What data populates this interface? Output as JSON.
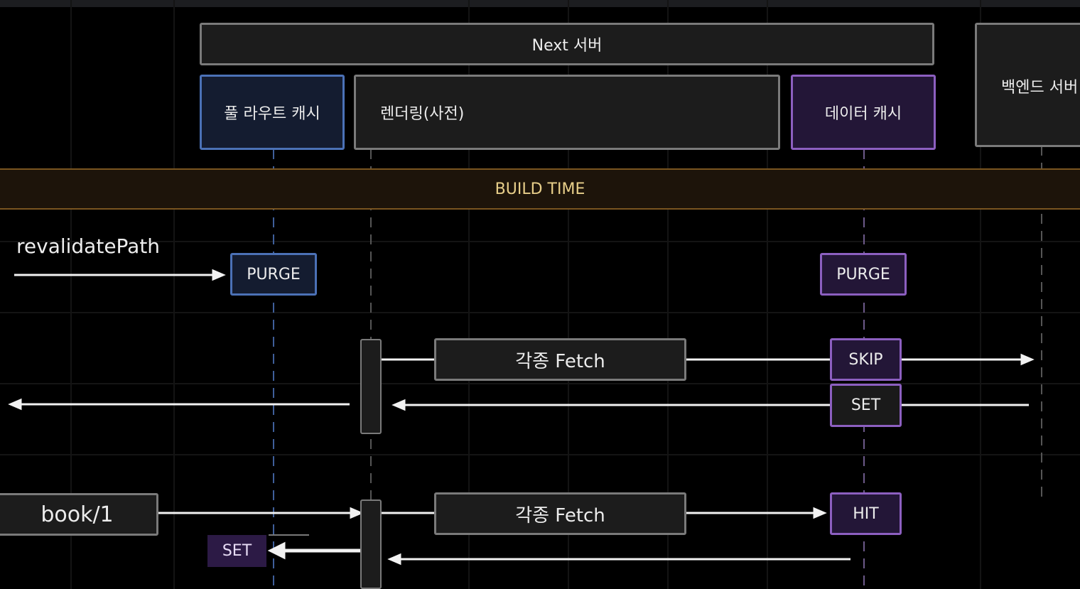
{
  "header": {
    "server": "Next 서버",
    "backend": "백엔드 서버"
  },
  "columns": {
    "full_route_cache": "풀 라우트 캐시",
    "rendering": "렌더링(사전)",
    "data_cache": "데이터 캐시"
  },
  "band": {
    "label": "BUILD TIME"
  },
  "flow1": {
    "trigger": "revalidatePath",
    "purge_route": "PURGE",
    "purge_data": "PURGE",
    "fetch": "각종 Fetch",
    "skip": "SKIP",
    "set": "SET"
  },
  "flow2": {
    "request": "book/1",
    "fetch": "각종 Fetch",
    "hit": "HIT",
    "set": "SET"
  },
  "colors": {
    "route_cache": "#4b71b6",
    "data_cache": "#8c5fc0",
    "build_band": "#7a5520"
  }
}
